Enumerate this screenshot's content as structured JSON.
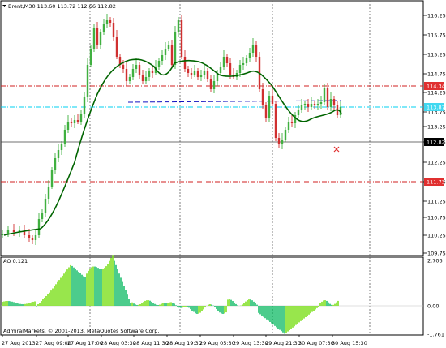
{
  "header": {
    "symbol_line": "Brent,M30  113.60 113.72 112.66 112.82"
  },
  "main_chart": {
    "price_axis": [
      "116.25",
      "115.75",
      "115.25",
      "114.75",
      "114.25",
      "113.75",
      "113.25",
      "112.75",
      "112.25",
      "111.75",
      "111.25",
      "110.75",
      "110.25",
      "109.75"
    ],
    "level_tags": [
      {
        "text": "114.34",
        "bg": "#e03030",
        "fg": "#ffffff"
      },
      {
        "text": "113.87",
        "bg": "#40d8f0",
        "fg": "#ffffff"
      },
      {
        "text": "112.82",
        "bg": "#000000",
        "fg": "#ffffff"
      },
      {
        "text": "111.73",
        "bg": "#e03030",
        "fg": "#ffffff"
      }
    ],
    "colors": {
      "resistance_line": "#d02020",
      "current_level_line": "#00d0f0",
      "moving_average": "#006400",
      "bull_candle": "#40b040",
      "bear_candle": "#d03030",
      "trend_line": "#1010c0"
    }
  },
  "ao_panel": {
    "label": "AO 0.121",
    "scale": [
      "2.706",
      "0.00",
      "-1.761"
    ],
    "colors": {
      "rising": "#7fe020",
      "falling": "#20c070"
    }
  },
  "time_axis": [
    "27 Aug 2013",
    "27 Aug 09:00",
    "27 Aug 17:00",
    "28 Aug 03:30",
    "28 Aug 11:30",
    "28 Aug 19:30",
    "29 Aug 05:30",
    "29 Aug 13:30",
    "29 Aug 21:30",
    "30 Aug 07:30",
    "30 Aug 15:30"
  ],
  "footer": {
    "copyright": "AdmiralMarkets, © 2001-2013, MetaQuotes Software Corp."
  }
}
